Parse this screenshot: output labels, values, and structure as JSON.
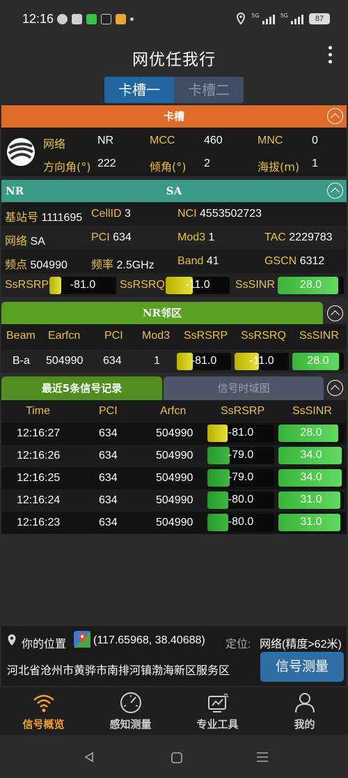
{
  "status_bar": {
    "time": "12:16",
    "network_left": "5G",
    "network_right": "5G",
    "battery": "87"
  },
  "app": {
    "title": "网优任我行"
  },
  "sim_tabs": [
    {
      "label": "卡槽一",
      "active": true
    },
    {
      "label": "卡槽二",
      "active": false
    }
  ],
  "card": {
    "header": "卡槽",
    "network_label": "网络",
    "network_value": "NR",
    "mcc_label": "MCC",
    "mcc_value": "460",
    "mnc_label": "MNC",
    "mnc_value": "0",
    "azimuth_label": "方向角(°)",
    "azimuth_value": "222",
    "tilt_label": "倾角(°)",
    "tilt_value": "2",
    "altitude_label": "海拔(m)",
    "altitude_value": "1"
  },
  "nr": {
    "header_left": "NR",
    "header_center": "SA",
    "station_label": "基站号",
    "station_value": "1111695",
    "cellid_label": "CellID",
    "cellid_value": "3",
    "nci_label": "NCI",
    "nci_value": "4553502723",
    "net_label": "网络",
    "net_value": "SA",
    "pci_label": "PCI",
    "pci_value": "634",
    "mod3_label": "Mod3",
    "mod3_value": "1",
    "tac_label": "TAC",
    "tac_value": "2229783",
    "freq_point_label": "频点",
    "freq_point_value": "504990",
    "freq_label": "频率",
    "freq_value": "2.5GHz",
    "band_label": "Band",
    "band_value": "41",
    "gscn_label": "GSCN",
    "gscn_value": "6312",
    "ssrsrp_label": "SsRSRP",
    "ssrsrp_value": "-81.0",
    "ssrsrp_level": 0.18,
    "ssrsrq_label": "SsRSRQ",
    "ssrsrq_value": "-11.0",
    "ssrsrq_level": 0.42,
    "sssinr_label": "SsSINR",
    "sssinr_value": "28.0",
    "sssinr_level": 0.92
  },
  "neighbors": {
    "header": "NR邻区",
    "columns": [
      "Beam",
      "Earfcn",
      "PCI",
      "Mod3",
      "SsRSRP",
      "SsRSRQ",
      "SsSINR"
    ],
    "rows": [
      {
        "beam": "B-a",
        "earfcn": "504990",
        "pci": "634",
        "mod3": "1",
        "ssrsrp": "-81.0",
        "ssrsrp_level": 0.3,
        "ssrsrq": "-11.0",
        "ssrsrq_level": 0.45,
        "sssinr": "28.0",
        "sssinr_level": 0.9
      }
    ]
  },
  "records": {
    "tab_active": "最近5条信号记录",
    "tab_inactive": "信号时域图",
    "columns": [
      "Time",
      "PCI",
      "Arfcn",
      "SsRSRP",
      "SsSINR"
    ],
    "rows": [
      {
        "time": "12:16:27",
        "pci": "634",
        "arfcn": "504990",
        "ssrsrp": "-81.0",
        "ssrsrp_level": 0.3,
        "ssrsrp_color": "yellow",
        "sssinr": "28.0",
        "sssinr_level": 0.92
      },
      {
        "time": "12:16:26",
        "pci": "634",
        "arfcn": "504990",
        "ssrsrp": "-79.0",
        "ssrsrp_level": 0.33,
        "ssrsrp_color": "dgreen",
        "sssinr": "34.0",
        "sssinr_level": 0.97
      },
      {
        "time": "12:16:25",
        "pci": "634",
        "arfcn": "504990",
        "ssrsrp": "-79.0",
        "ssrsrp_level": 0.33,
        "ssrsrp_color": "dgreen",
        "sssinr": "34.0",
        "sssinr_level": 0.97
      },
      {
        "time": "12:16:24",
        "pci": "634",
        "arfcn": "504990",
        "ssrsrp": "-80.0",
        "ssrsrp_level": 0.31,
        "ssrsrp_color": "dgreen",
        "sssinr": "31.0",
        "sssinr_level": 0.95
      },
      {
        "time": "12:16:23",
        "pci": "634",
        "arfcn": "504990",
        "ssrsrp": "-80.0",
        "ssrsrp_level": 0.31,
        "ssrsrp_color": "dgreen",
        "sssinr": "31.0",
        "sssinr_level": 0.95
      }
    ]
  },
  "location": {
    "label": "你的位置",
    "coords": "(117.65968, 38.40688)",
    "positioning_label": "定位:",
    "positioning_value": "网络(精度>62米)",
    "address": "河北省沧州市黄骅市南排河镇渤海新区服务区",
    "measure_button": "信号测量"
  },
  "bottom_nav": [
    {
      "label": "信号概览",
      "icon": "wifi-signal-icon",
      "active": true
    },
    {
      "label": "感知测量",
      "icon": "gauge-icon",
      "active": false
    },
    {
      "label": "专业工具",
      "icon": "tools-icon",
      "active": false
    },
    {
      "label": "我的",
      "icon": "user-icon",
      "active": false
    }
  ],
  "colors": {
    "card_header": "#e06a27",
    "nr_header": "#3a9a88",
    "neighbor_header": "#5aa023",
    "records_tab": "#4f8e1f",
    "active_nav": "#f0a030"
  }
}
